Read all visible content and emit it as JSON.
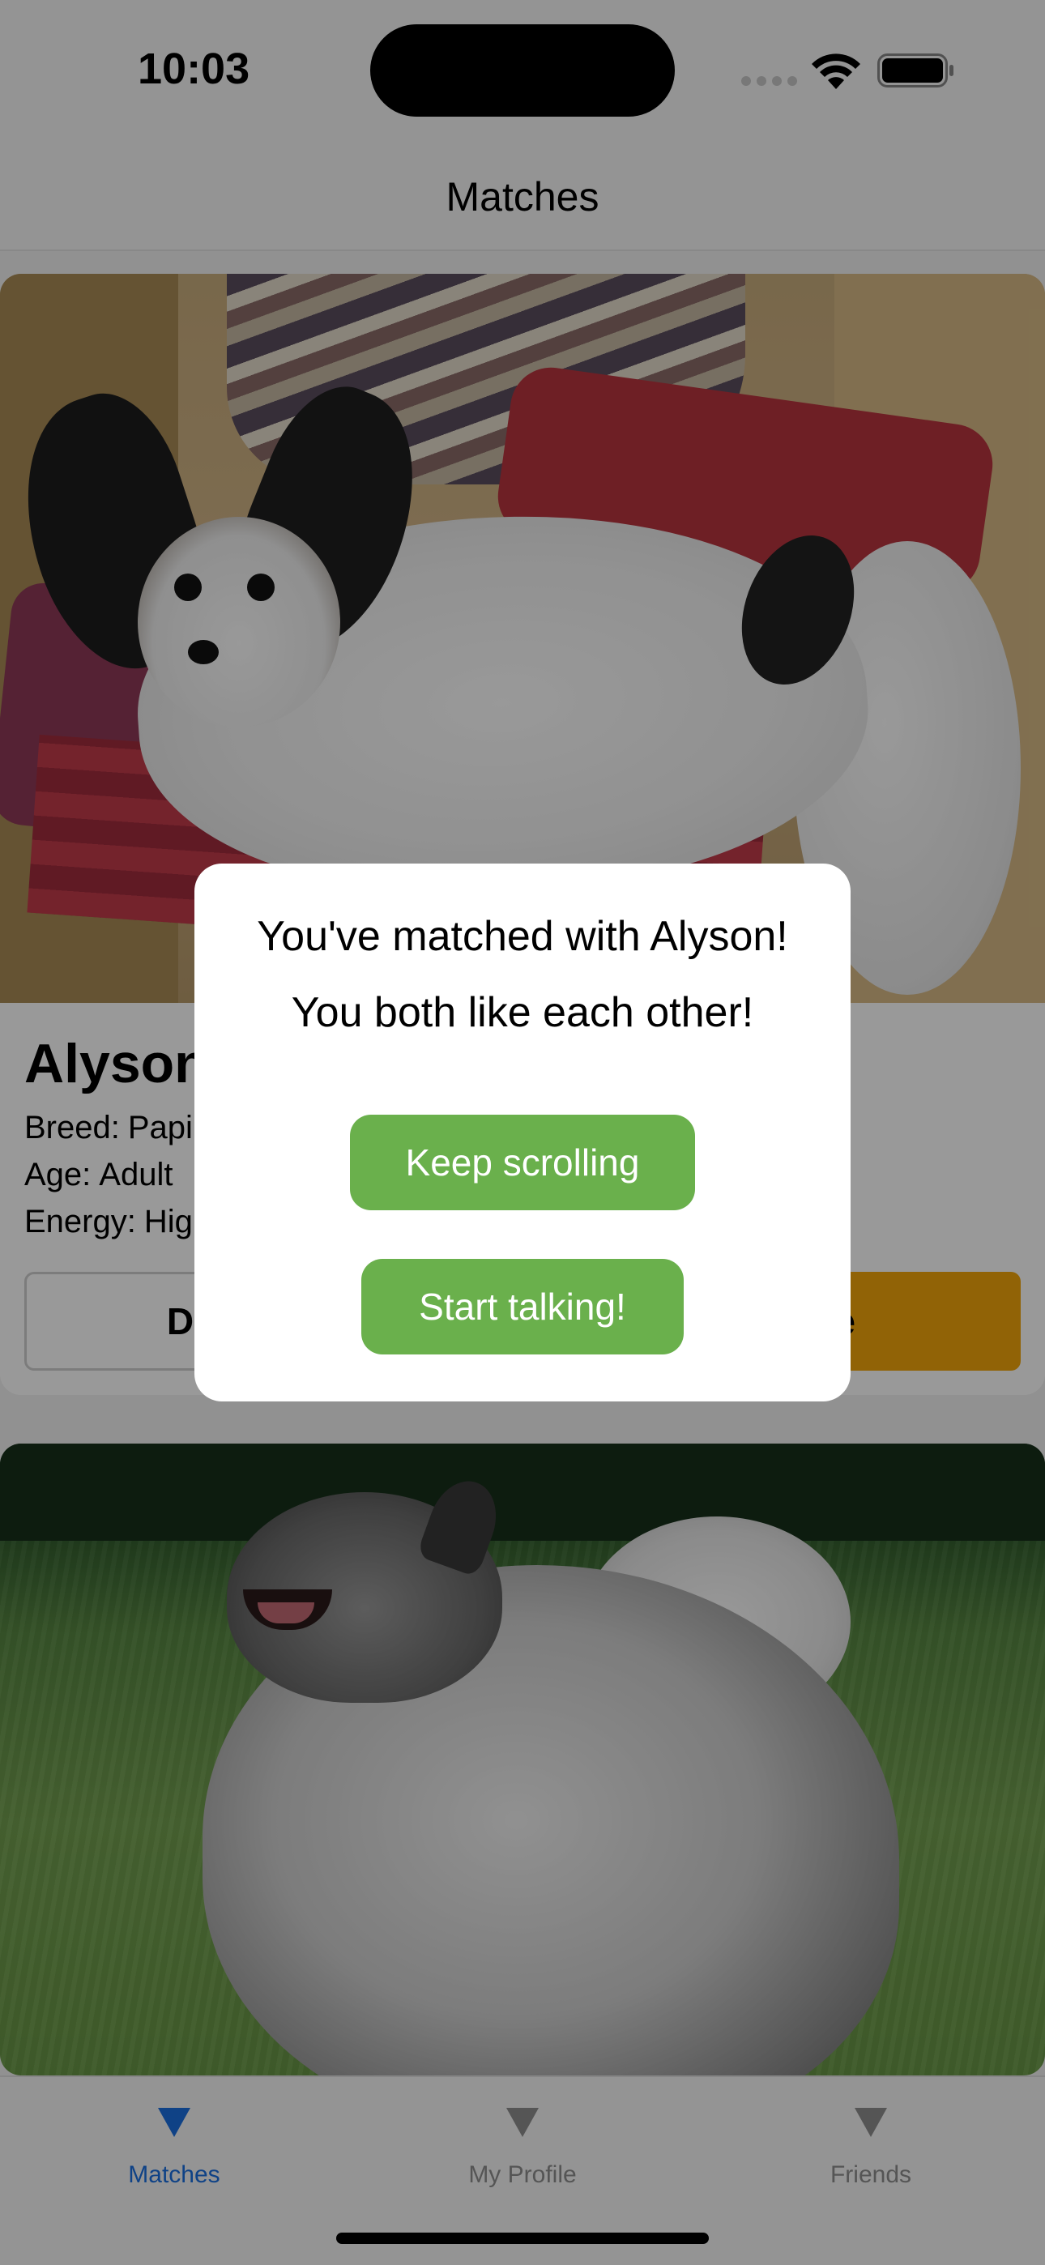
{
  "status_bar": {
    "time": "10:03",
    "icons": [
      "cellular-signal-icon",
      "wifi-icon",
      "battery-icon"
    ]
  },
  "header": {
    "title": "Matches"
  },
  "feed": {
    "cards": [
      {
        "name": "Alyson",
        "breed_label": "Breed:",
        "breed": "Papillon",
        "age_label": "Age:",
        "age": "Adult",
        "energy_label": "Energy:",
        "energy": "High",
        "dislike_label": "Dislike",
        "like_label": "Like",
        "like_color": "#f2a60b"
      }
    ]
  },
  "modal": {
    "title": "You've matched with Alyson!",
    "subtitle": "You both like each other!",
    "keep_scrolling_label": "Keep scrolling",
    "start_talking_label": "Start talking!",
    "button_color": "#6ab04c"
  },
  "tab_bar": {
    "tabs": [
      {
        "label": "Matches",
        "icon": "triangle-down-icon",
        "active": true
      },
      {
        "label": "My Profile",
        "icon": "triangle-down-icon",
        "active": false
      },
      {
        "label": "Friends",
        "icon": "triangle-down-icon",
        "active": false
      }
    ],
    "active_color": "#1a6ee0",
    "inactive_color": "#8e8e8e"
  }
}
